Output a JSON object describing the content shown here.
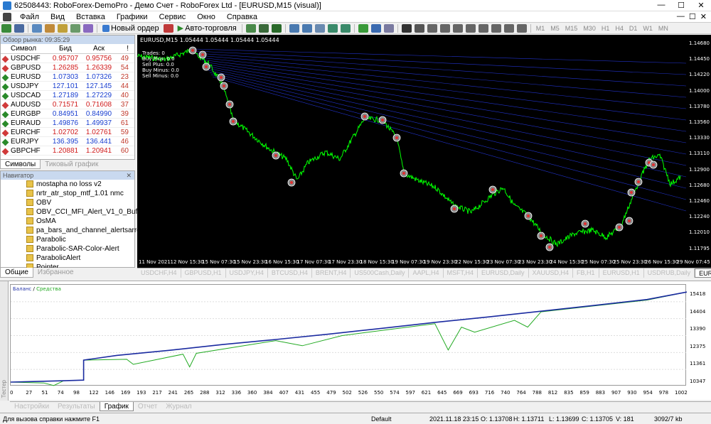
{
  "window": {
    "title": "62508443: RoboForex-DemoPro - Демо Счет - RoboForex Ltd - [EURUSD,M15 (visual)]",
    "min": "—",
    "max": "☐",
    "close": "✕"
  },
  "menu": [
    "Файл",
    "Вид",
    "Вставка",
    "Графики",
    "Сервис",
    "Окно",
    "Справка"
  ],
  "toolbar": {
    "new_order": "Новый ордер",
    "autotrading": "Авто-торговля",
    "timeframes": [
      "M1",
      "M5",
      "M15",
      "M30",
      "H1",
      "H4",
      "D1",
      "W1",
      "MN"
    ]
  },
  "market_watch": {
    "header": "Обзор рынка: 09:35:29",
    "columns": [
      "Символ",
      "Бид",
      "Аск",
      "!"
    ],
    "rows": [
      {
        "symbol": "USDCHF",
        "bid": "0.95707",
        "ask": "0.95756",
        "spread": "49",
        "dir": "down"
      },
      {
        "symbol": "GBPUSD",
        "bid": "1.26285",
        "ask": "1.26339",
        "spread": "54",
        "dir": "down"
      },
      {
        "symbol": "EURUSD",
        "bid": "1.07303",
        "ask": "1.07326",
        "spread": "23",
        "dir": "up"
      },
      {
        "symbol": "USDJPY",
        "bid": "127.101",
        "ask": "127.145",
        "spread": "44",
        "dir": "up"
      },
      {
        "symbol": "USDCAD",
        "bid": "1.27189",
        "ask": "1.27229",
        "spread": "40",
        "dir": "up"
      },
      {
        "symbol": "AUDUSD",
        "bid": "0.71571",
        "ask": "0.71608",
        "spread": "37",
        "dir": "down"
      },
      {
        "symbol": "EURGBP",
        "bid": "0.84951",
        "ask": "0.84990",
        "spread": "39",
        "dir": "up"
      },
      {
        "symbol": "EURAUD",
        "bid": "1.49876",
        "ask": "1.49937",
        "spread": "61",
        "dir": "up"
      },
      {
        "symbol": "EURCHF",
        "bid": "1.02702",
        "ask": "1.02761",
        "spread": "59",
        "dir": "down"
      },
      {
        "symbol": "EURJPY",
        "bid": "136.395",
        "ask": "136.441",
        "spread": "46",
        "dir": "up"
      },
      {
        "symbol": "GBPCHF",
        "bid": "1.20881",
        "ask": "1.20941",
        "spread": "60",
        "dir": "down"
      }
    ],
    "tabs": [
      "Символы",
      "Тиковый график"
    ]
  },
  "navigator": {
    "header": "Навигатор",
    "items": [
      "mostapha no loss v2",
      "nrtr_atr_stop_mtf_1.01 nmc",
      "OBV",
      "OBV_CCI_MFI_Alert_V1_0_Buffers",
      "OsMA",
      "pa_bars_and_channel_alertsarrows",
      "Parabolic",
      "Parabolic-SAR-Color-Alert",
      "ParabolicAlert",
      "Pointer"
    ],
    "tabs": [
      "Общие",
      "Избранное"
    ]
  },
  "chart": {
    "symbol_label": "EURUSD,M15  1.05444 1.05444 1.05444 1.05444",
    "info_lines": [
      "Trades: 0",
      "Buy Plus: 0.0",
      "Sell Plus: 0.0",
      "Buy Minus: 0.0",
      "Sell Minus: 0.0"
    ],
    "price_ticks": [
      "1.14680",
      "1.14450",
      "1.14220",
      "1.14000",
      "1.13780",
      "1.13560",
      "1.13330",
      "1.13110",
      "1.12900",
      "1.12680",
      "1.12460",
      "1.12240",
      "1.12010",
      "1.11795"
    ],
    "time_ticks": [
      "11 Nov 2021",
      "12 Nov 15:30",
      "15 Nov 07:30",
      "15 Nov 23:30",
      "16 Nov 15:30",
      "17 Nov 07:30",
      "17 Nov 23:30",
      "18 Nov 15:30",
      "19 Nov 07:30",
      "19 Nov 23:30",
      "22 Nov 15:30",
      "23 Nov 07:30",
      "23 Nov 23:30",
      "24 Nov 15:30",
      "25 Nov 07:30",
      "25 Nov 23:30",
      "26 Nov 15:30",
      "29 Nov 07:45"
    ],
    "colors": {
      "bg": "#000000",
      "price_line": "#00ff00",
      "grid_lines": "#2233cc"
    }
  },
  "chart_tabs": [
    "USDCHF,H4",
    "GBPUSD,H1",
    "USDJPY,H4",
    "BTCUSD,H4",
    "BRENT,H4",
    "US500Cash,Daily",
    "AAPL,H4",
    "MSFT,H4",
    "EURUSD,Daily",
    "XAUUSD,H4",
    "FB,H1",
    "EURUSD,H1",
    "USDRUB,Daily",
    "EURUSD,M15"
  ],
  "tester": {
    "side_label": "Тестер",
    "legend_balance": "Баланс",
    "legend_equity": "Средства",
    "y_ticks": [
      "15418",
      "14404",
      "13390",
      "12375",
      "11361",
      "10347"
    ],
    "x_ticks": [
      "0",
      "27",
      "51",
      "74",
      "98",
      "122",
      "146",
      "169",
      "193",
      "217",
      "241",
      "265",
      "288",
      "312",
      "336",
      "360",
      "384",
      "407",
      "431",
      "455",
      "479",
      "502",
      "526",
      "550",
      "574",
      "597",
      "621",
      "645",
      "669",
      "693",
      "716",
      "740",
      "764",
      "788",
      "812",
      "835",
      "859",
      "883",
      "907",
      "930",
      "954",
      "978",
      "1002"
    ],
    "tabs": [
      "Настройки",
      "Результаты",
      "График",
      "Отчет",
      "Журнал"
    ]
  },
  "chart_data": {
    "type": "line",
    "title": "",
    "xlabel": "",
    "ylabel": "",
    "xlim": [
      0,
      1020
    ],
    "ylim": [
      9900,
      15900
    ],
    "series": [
      {
        "name": "Баланс",
        "color": "#1a2aa0",
        "x": [
          0,
          40,
          80,
          110,
          110,
          160,
          240,
          320,
          400,
          480,
          560,
          640,
          720,
          800,
          880,
          960,
          1020
        ],
        "y": [
          10150,
          10190,
          10230,
          10270,
          11450,
          11730,
          12030,
          12370,
          12670,
          12990,
          13330,
          13680,
          14000,
          14340,
          14680,
          15030,
          15470
        ]
      },
      {
        "name": "Средства",
        "color": "#22aa22",
        "x": [
          0,
          50,
          65,
          80,
          110,
          110,
          175,
          185,
          260,
          270,
          280,
          400,
          440,
          500,
          560,
          640,
          660,
          680,
          700,
          760,
          780,
          800,
          880,
          960,
          1020
        ],
        "y": [
          10150,
          10100,
          9950,
          10230,
          10270,
          11450,
          11500,
          11200,
          11800,
          11050,
          11850,
          12600,
          12300,
          12900,
          13200,
          13600,
          12050,
          13400,
          13100,
          13800,
          13400,
          14300,
          14650,
          15000,
          15470
        ]
      }
    ]
  },
  "status": {
    "help": "Для вызова справки нажмите F1",
    "profile": "Default",
    "datetime": "2021.11.18 23:15",
    "open": "O: 1.13708",
    "high": "H: 1.13711",
    "low": "L: 1.13699",
    "close": "C: 1.13705",
    "volume": "V: 181",
    "traffic": "3092/7 kb"
  }
}
